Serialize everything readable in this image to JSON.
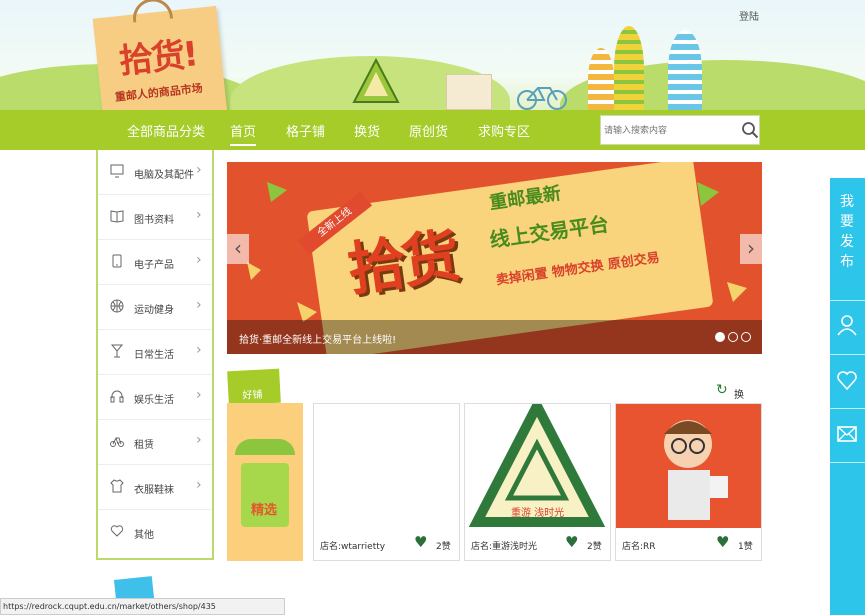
{
  "header": {
    "logo_title": "拾货!",
    "logo_subtitle": "重邮人的商品市场",
    "login_label": "登陆"
  },
  "nav": {
    "items": [
      "全部商品分类",
      "首页",
      "格子铺",
      "换货",
      "原创货",
      "求购专区"
    ],
    "active_index": 1,
    "search_placeholder": "请输入搜索内容"
  },
  "categories": [
    {
      "label": "电脑及其配件",
      "icon": "monitor-icon"
    },
    {
      "label": "图书资料",
      "icon": "book-icon"
    },
    {
      "label": "电子产品",
      "icon": "phone-icon"
    },
    {
      "label": "运动健身",
      "icon": "basketball-icon"
    },
    {
      "label": "日常生活",
      "icon": "cup-icon"
    },
    {
      "label": "娱乐生活",
      "icon": "headphones-icon"
    },
    {
      "label": "租赁",
      "icon": "bicycle-icon"
    },
    {
      "label": "衣服鞋袜",
      "icon": "shirt-icon"
    },
    {
      "label": "其他",
      "icon": "heart-icon"
    }
  ],
  "carousel": {
    "tag": "全新上线",
    "title": "拾货",
    "line1": "重邮最新",
    "line2": "线上交易平台",
    "line3": "卖掉闲置  物物交换  原创交易",
    "caption": "拾货·重邮全新线上交易平台上线啦!",
    "dots": 3,
    "active_dot": 0
  },
  "shops": {
    "section_label": "好铺",
    "refresh_label": "换一批",
    "feature_label": "精选",
    "items": [
      {
        "name": "店名:wtarrietty",
        "likes": "2赞",
        "image": "blank"
      },
      {
        "name": "店名:重游浅时光",
        "likes": "2赞",
        "image": "badge"
      },
      {
        "name": "店名:RR",
        "likes": "1赞",
        "image": "cartoon"
      }
    ]
  },
  "float_bar": {
    "publish_label": "我要发布",
    "icons": [
      "user-icon",
      "heart-icon",
      "mail-icon"
    ]
  },
  "status_url": "https://redrock.cqupt.edu.cn/market/others/shop/435",
  "colors": {
    "nav_green": "#a6cc29",
    "float_blue": "#2ec5ea",
    "carousel_orange": "#e2532d"
  }
}
